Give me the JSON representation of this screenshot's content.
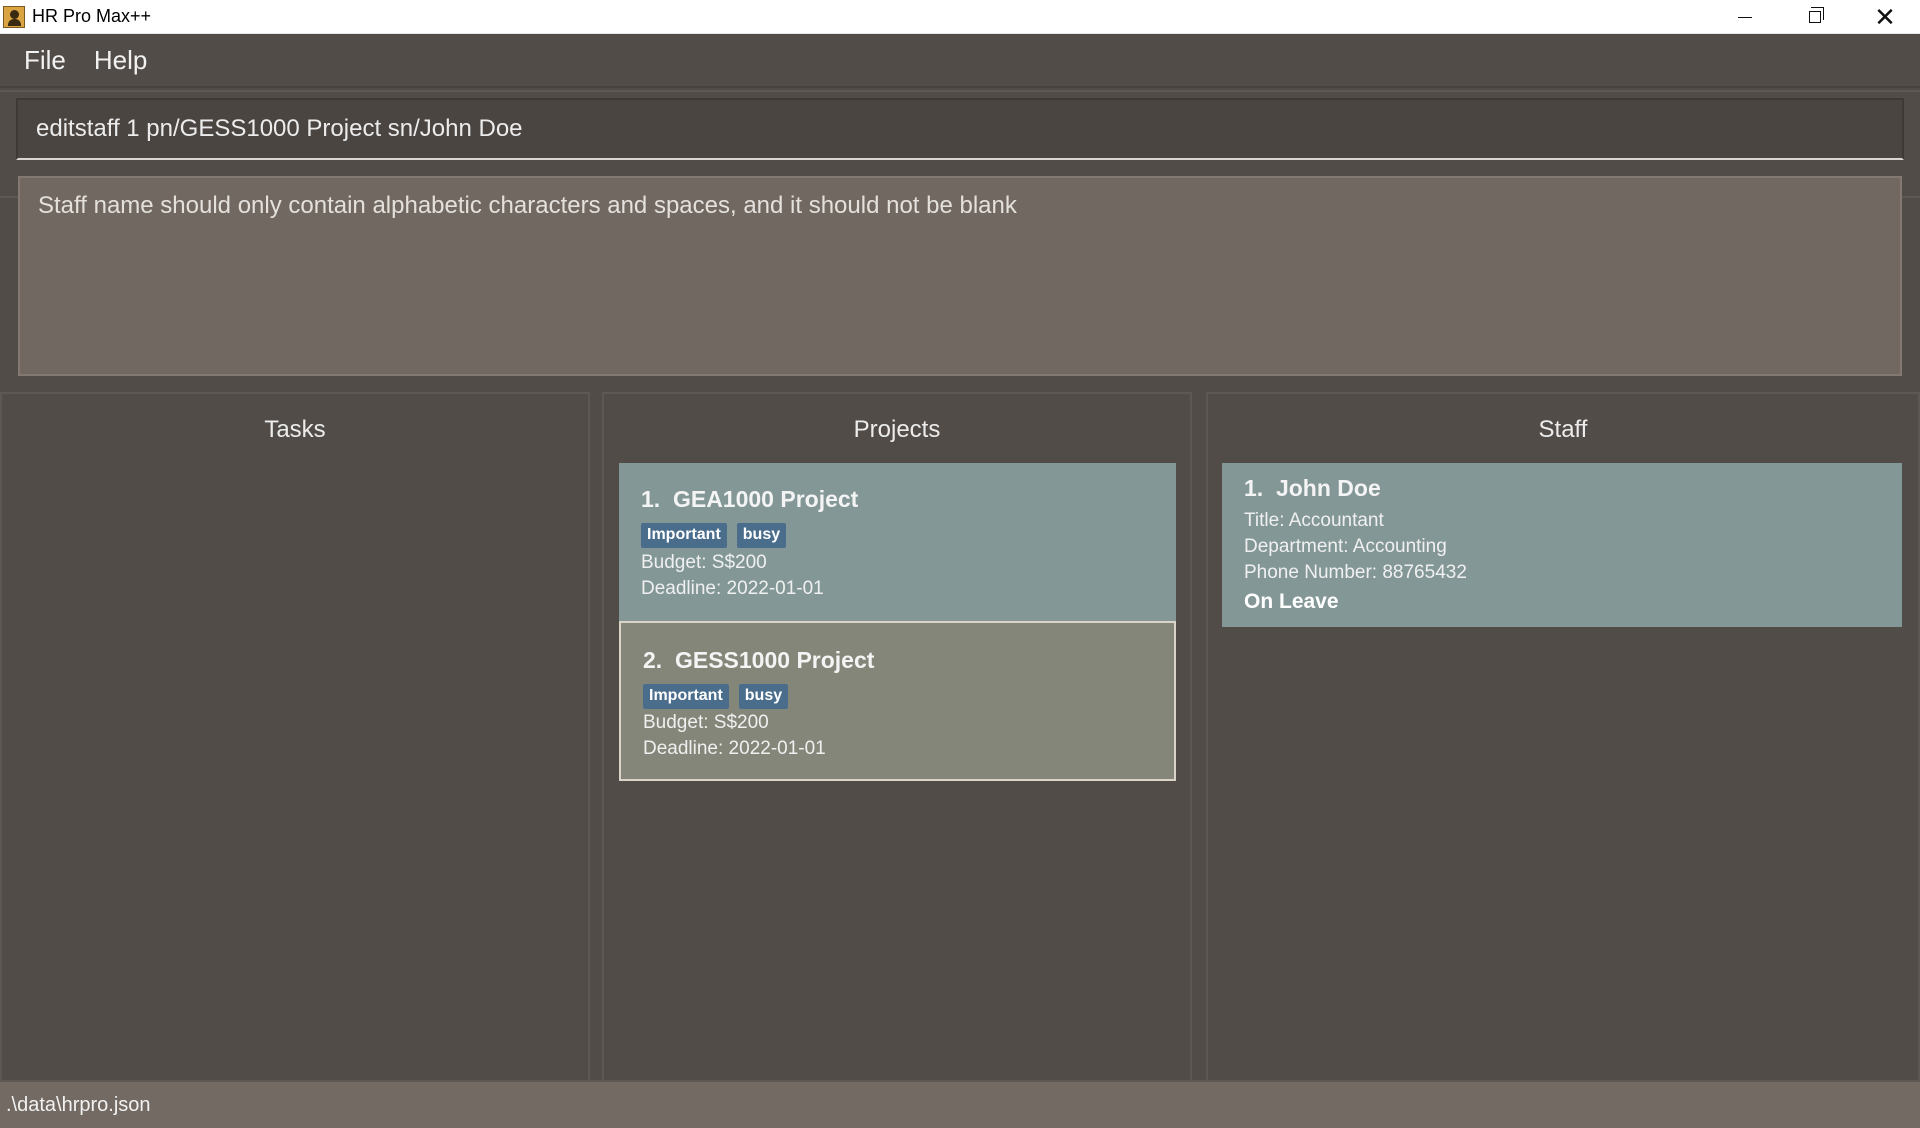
{
  "window": {
    "title": "HR Pro Max++",
    "controls": {
      "minimize_icon": "minimize-icon",
      "maximize_icon": "restore-icon",
      "close_glyph": "✕"
    }
  },
  "menu": {
    "file": "File",
    "help": "Help"
  },
  "command": {
    "value": "editstaff 1 pn/GESS1000 Project sn/John Doe"
  },
  "result": {
    "message": "Staff name should only contain alphabetic characters and spaces, and it should not be blank"
  },
  "panels": {
    "tasks": {
      "title": "Tasks"
    },
    "projects": {
      "title": "Projects",
      "items": [
        {
          "index": "1.",
          "name": "GEA1000 Project",
          "tags": [
            "Important",
            "busy"
          ],
          "budget": "Budget: S$200",
          "deadline": "Deadline: 2022-01-01"
        },
        {
          "index": "2.",
          "name": "GESS1000 Project",
          "tags": [
            "Important",
            "busy"
          ],
          "budget": "Budget: S$200",
          "deadline": "Deadline: 2022-01-01"
        }
      ]
    },
    "staff": {
      "title": "Staff",
      "items": [
        {
          "index": "1.",
          "name": "John Doe",
          "title": "Title: Accountant",
          "department": "Department: Accounting",
          "phone": "Phone Number: 88765432",
          "status": "On Leave"
        }
      ]
    }
  },
  "status_bar": {
    "path": ".\\data\\hrpro.json"
  },
  "colors": {
    "background": "#524c48",
    "result_box": "#716861",
    "card": "#849797",
    "card_selected": "#848679",
    "tag": "#4a6d8c"
  }
}
